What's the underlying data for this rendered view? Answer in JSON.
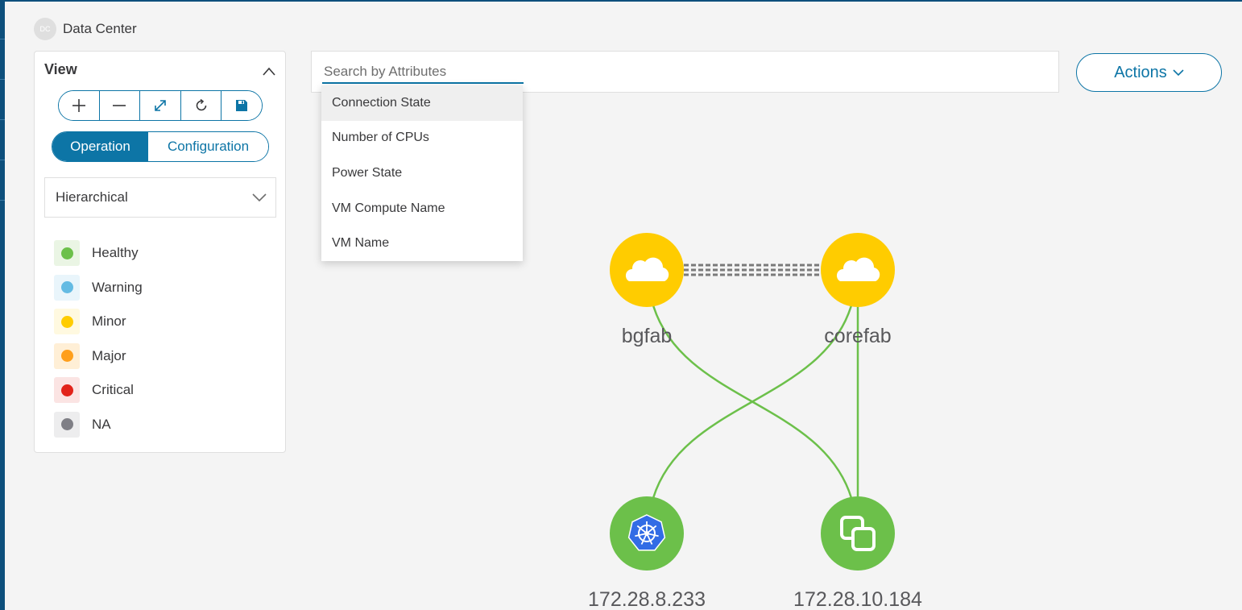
{
  "breadcrumb": {
    "avatar": "DC",
    "title": "Data Center"
  },
  "view_panel": {
    "title": "View",
    "toolbar": [
      {
        "name": "zoom-in-icon"
      },
      {
        "name": "zoom-out-icon"
      },
      {
        "name": "fit-to-screen-icon"
      },
      {
        "name": "refresh-icon"
      },
      {
        "name": "save-icon"
      }
    ],
    "modes": {
      "active": "Operation",
      "inactive": "Configuration"
    },
    "layout_select": {
      "value": "Hierarchical"
    },
    "legend": [
      {
        "label": "Healthy",
        "color": "#6cc04a",
        "bg": "#eaf5e4"
      },
      {
        "label": "Warning",
        "color": "#64bbe3",
        "bg": "#e9f5fb"
      },
      {
        "label": "Minor",
        "color": "#ffcc00",
        "bg": "#fff9e0"
      },
      {
        "label": "Major",
        "color": "#ff9f1c",
        "bg": "#ffefd6"
      },
      {
        "label": "Critical",
        "color": "#e2231a",
        "bg": "#fbe4e3"
      },
      {
        "label": "NA",
        "color": "#7f7f86",
        "bg": "#ededee"
      }
    ]
  },
  "search": {
    "placeholder": "Search by Attributes",
    "value": ""
  },
  "actions": {
    "label": "Actions"
  },
  "attribute_dropdown": {
    "items": [
      "Connection State",
      "Number of CPUs",
      "Power State",
      "VM Compute Name",
      "VM Name"
    ],
    "highlighted_index": 0
  },
  "topology": {
    "nodes": [
      {
        "id": "bgfab",
        "label": "bgfab",
        "status": "Minor",
        "icon": "cloud-icon"
      },
      {
        "id": "corefab",
        "label": "corefab",
        "status": "Minor",
        "icon": "cloud-icon"
      },
      {
        "id": "k8s",
        "label": "172.28.8.233",
        "status": "Healthy",
        "icon": "kubernetes-icon"
      },
      {
        "id": "vmware",
        "label": "172.28.10.184",
        "status": "Healthy",
        "icon": "vmware-icon"
      }
    ],
    "links": [
      {
        "from": "bgfab",
        "to": "corefab",
        "style": "dashed-double"
      },
      {
        "from": "bgfab",
        "to": "vmware",
        "style": "healthy"
      },
      {
        "from": "corefab",
        "to": "k8s",
        "style": "healthy"
      },
      {
        "from": "corefab",
        "to": "vmware",
        "style": "healthy"
      }
    ],
    "colors": {
      "minor": "#ffcc00",
      "healthy": "#6cc04a",
      "link": "#6cc04a"
    }
  }
}
